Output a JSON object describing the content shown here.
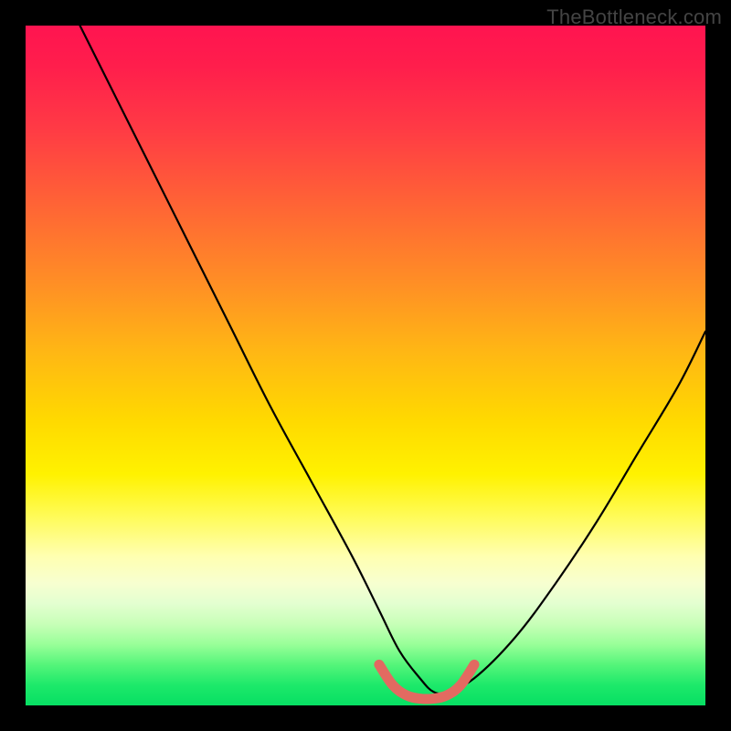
{
  "watermark": "TheBottleneck.com",
  "chart_data": {
    "type": "line",
    "title": "",
    "xlabel": "",
    "ylabel": "",
    "xlim": [
      0,
      100
    ],
    "ylim": [
      0,
      100
    ],
    "series": [
      {
        "name": "black-curve",
        "color": "#000000",
        "x": [
          8,
          12,
          18,
          24,
          30,
          36,
          42,
          48,
          52,
          55,
          58,
          60,
          62,
          66,
          72,
          78,
          84,
          90,
          96,
          100
        ],
        "y": [
          100,
          92,
          80,
          68,
          56,
          44,
          33,
          22,
          14,
          8,
          4,
          2,
          2,
          4,
          10,
          18,
          27,
          37,
          47,
          55
        ]
      },
      {
        "name": "red-bracket",
        "color": "#e26a61",
        "x": [
          52,
          54,
          56,
          58,
          60,
          62,
          64,
          66
        ],
        "y": [
          6,
          3,
          1.5,
          1,
          1,
          1.5,
          3,
          6
        ]
      }
    ],
    "annotations": []
  }
}
